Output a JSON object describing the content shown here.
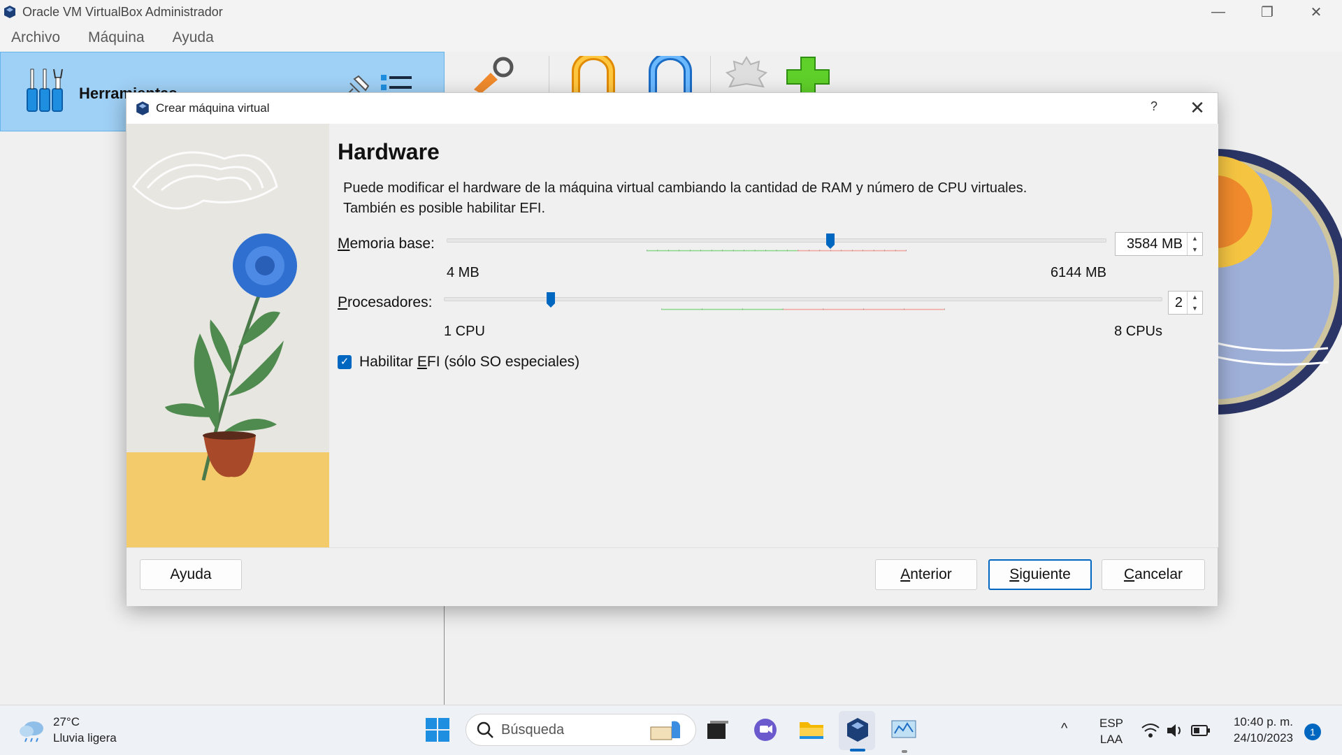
{
  "window": {
    "title": "Oracle VM VirtualBox Administrador",
    "minimize": "—",
    "maximize": "❐",
    "close": "✕"
  },
  "menu": [
    "Archivo",
    "Máquina",
    "Ayuda"
  ],
  "tools_panel": {
    "label": "Herramientas"
  },
  "dialog": {
    "title": "Crear máquina virtual",
    "help_glyph": "?",
    "close_glyph": "✕",
    "heading": "Hardware",
    "description_line1": "Puede modificar el hardware de la máquina virtual cambiando la cantidad de RAM y número de CPU virtuales.",
    "description_line2": "También es posible habilitar EFI.",
    "memory": {
      "label_prefix": "M",
      "label_rest": "emoria base:",
      "value_text": "3584 MB",
      "min_label": "4 MB",
      "max_label": "6144 MB",
      "value": 3584,
      "min": 4,
      "max": 6144
    },
    "processors": {
      "label_prefix": "P",
      "label_rest": "rocesadores:",
      "value_text": "2",
      "min_label": "1 CPU",
      "max_label": "8 CPUs",
      "value": 2,
      "min": 1,
      "max": 8
    },
    "efi": {
      "checked": true,
      "label_before": "Habilitar ",
      "label_ul": "E",
      "label_after": "FI (sólo SO especiales)"
    },
    "buttons": {
      "help": "Ayuda",
      "back_ul": "A",
      "back_rest": "nterior",
      "next_ul": "S",
      "next_rest": "iguiente",
      "cancel_ul": "C",
      "cancel_rest": "ancelar"
    }
  },
  "taskbar": {
    "weather_temp": "27°C",
    "weather_desc": "Lluvia ligera",
    "search_placeholder": "Búsqueda",
    "lang_top": "ESP",
    "lang_bottom": "LAA",
    "time": "10:40 p. m.",
    "date": "24/10/2023",
    "notifications": "1",
    "tray_chevron": "^"
  },
  "colors": {
    "accent": "#0067c0",
    "tools_panel_bg": "#9fd0f5",
    "slider_green": "#8fd98f",
    "slider_red": "#f0a9a0"
  }
}
